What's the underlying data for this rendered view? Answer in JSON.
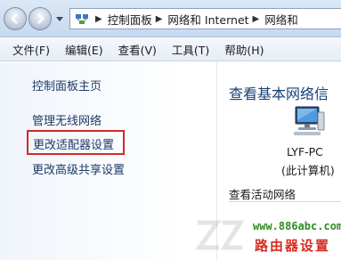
{
  "breadcrumb": {
    "items": [
      "控制面板",
      "网络和 Internet",
      "网络和"
    ]
  },
  "menu": {
    "items": [
      "文件(F)",
      "编辑(E)",
      "查看(V)",
      "工具(T)",
      "帮助(H)"
    ]
  },
  "sidebar": {
    "items": [
      {
        "label": "控制面板主页"
      },
      {
        "label": "管理无线网络"
      },
      {
        "label": "更改适配器设置",
        "highlighted": true
      },
      {
        "label": "更改高级共享设置"
      }
    ]
  },
  "main": {
    "title": "查看基本网络信",
    "computer": {
      "name": "LYF-PC",
      "subtitle": "(此计算机)",
      "icon": "computer-icon"
    },
    "active_networks_label": "查看活动网络"
  },
  "watermark": {
    "url": "www.886abc.com",
    "site_title": "路由器设置"
  },
  "colors": {
    "highlight_border": "#d22a24",
    "link": "#1f3a66",
    "title": "#16407a",
    "watermark_url": "#2e8c1f",
    "watermark_title": "#d92a1e"
  }
}
